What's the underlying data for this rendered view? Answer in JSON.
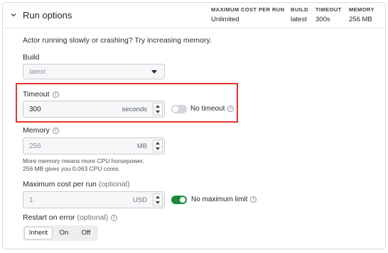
{
  "header": {
    "title": "Run options",
    "summary": [
      {
        "label": "MAXIMUM COST PER RUN",
        "value": "Unlimited"
      },
      {
        "label": "BUILD",
        "value": "latest"
      },
      {
        "label": "TIMEOUT",
        "value": "300s"
      },
      {
        "label": "MEMORY",
        "value": "256 MB"
      }
    ]
  },
  "intro": "Actor running slowly or crashing? Try increasing memory.",
  "build": {
    "label": "Build",
    "placeholder": "latest"
  },
  "timeout": {
    "label": "Timeout",
    "value": "300",
    "unit": "seconds",
    "toggle_label": "No timeout",
    "toggle_on": false
  },
  "memory": {
    "label": "Memory",
    "value": "256",
    "unit": "MB",
    "help_line1": "More memory means more CPU horsepower.",
    "help_line2": "256 MB gives you 0.063 CPU cores."
  },
  "max_cost": {
    "label": "Maximum cost per run",
    "optional": "(optional)",
    "value": "1",
    "unit": "USD",
    "toggle_label": "No maximum limit",
    "toggle_on": true
  },
  "restart": {
    "label": "Restart on error",
    "optional": "(optional)",
    "options": [
      "Inherit",
      "On",
      "Off"
    ],
    "selected": "Inherit"
  },
  "colors": {
    "accent_green": "#1b8a3a",
    "highlight_red": "#e4342a"
  },
  "icons": {
    "collapse": "chevron-down-icon",
    "info": "info-icon"
  }
}
